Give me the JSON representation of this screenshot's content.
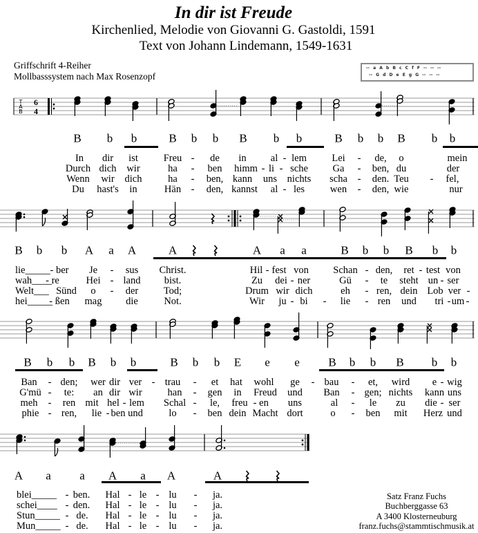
{
  "header": {
    "title": "In dir ist Freude",
    "subtitle_1": "Kirchenlied, Melodie von Giovanni G. Gastoldi, 1591",
    "subtitle_2": "Text von Johann Lindemann, 1549-1631"
  },
  "info": {
    "line_1": "Griffschrift 4-Reiher",
    "line_2": "Mollbasssystem nach Max Rosenzopf"
  },
  "legend": {
    "row_1": "-- a A b B c C f F -- -- --",
    "row_2": "-- G d D e E g G -- -- --"
  },
  "tab_label": [
    "T",
    "A",
    "B"
  ],
  "time_signature": {
    "top": "6",
    "bottom": "4"
  },
  "systems": [
    {
      "bass": [
        "B",
        "b",
        "b",
        "B",
        "b",
        "b",
        "B",
        "b",
        "b",
        "B",
        "b",
        "b",
        "B",
        "b",
        "b"
      ],
      "verses": [
        [
          "In",
          "dir",
          "ist",
          "Freu",
          "-",
          "de",
          "in",
          "al",
          "-",
          "lem",
          "Lei",
          "-",
          "de,",
          "o",
          "mein"
        ],
        [
          "Durch",
          "dich",
          "wir",
          "ha",
          "-",
          "ben",
          "himm",
          "-",
          "li",
          "-",
          "sche",
          "Ga",
          "-",
          "ben,",
          "du",
          "der"
        ],
        [
          "Wenn",
          "wir",
          "dich",
          "ha",
          "-",
          "ben,",
          "kann",
          "uns",
          "nichts",
          "scha",
          "-",
          "den.",
          "Teu",
          "-",
          "fel,"
        ],
        [
          "Du",
          "hast's",
          "in",
          "Hän",
          "-",
          "den,",
          "kannst",
          "al",
          "-",
          "les",
          "wen",
          "-",
          "den,",
          "wie",
          "nur"
        ]
      ]
    },
    {
      "bass": [
        "B",
        "b",
        "b",
        "A",
        "a",
        "A",
        "A",
        "rest",
        "rest",
        "A",
        "a",
        "a",
        "B",
        "b",
        "b",
        "B",
        "b",
        "b"
      ],
      "verses": [
        [
          "lie_____",
          "- ber",
          "Je",
          "-",
          "sus",
          "Christ.",
          "Hil",
          "-",
          "fest",
          "von",
          "Schan",
          "-",
          "den,",
          "ret",
          "-",
          "test",
          "von"
        ],
        [
          "wah____",
          "- re",
          "Hei",
          "-",
          "land",
          "bist.",
          "Zu",
          "dei",
          "-",
          "ner",
          "Gü",
          "-",
          "te",
          "steht",
          "un",
          "-",
          "ser"
        ],
        [
          "Welt___",
          "Sünd",
          "o",
          "-",
          "der",
          "Tod;",
          "Drum",
          "wir",
          "dich",
          "eh",
          "-",
          "ren,",
          "dein",
          "Lob",
          "ver",
          "-"
        ],
        [
          "hei_____",
          "- ßen",
          "mag",
          "die",
          "Not.",
          "Wir",
          "ju",
          "-",
          "bi",
          "-",
          "lie",
          "-",
          "ren",
          "und",
          "tri",
          "-",
          "um",
          "-"
        ]
      ]
    },
    {
      "bass": [
        "B",
        "b",
        "b",
        "B",
        "b",
        "b",
        "B",
        "b",
        "b",
        "E",
        "e",
        "e",
        "B",
        "b",
        "b",
        "B",
        "b",
        "b"
      ],
      "verses": [
        [
          "Ban",
          "-",
          "den;",
          "wer",
          "dir",
          "ver",
          "-",
          "trau",
          "-",
          "et",
          "hat",
          "wohl",
          "ge",
          "-",
          "bau",
          "-",
          "et,",
          "wird",
          "e",
          "-",
          "wig"
        ],
        [
          "G'mü",
          "-",
          "te:",
          "an",
          "dir",
          "wir",
          "han",
          "-",
          "gen",
          "in",
          "Freud",
          "und",
          "Ban",
          "-",
          "gen;",
          "nichts",
          "kann",
          "uns"
        ],
        [
          "meh",
          "-",
          "ren",
          "mit",
          "hel",
          "-",
          "lem",
          "Schal",
          "-",
          "le,",
          "freu",
          "-",
          "en",
          "uns",
          "al",
          "-",
          "le",
          "zu",
          "die",
          "-",
          "ser"
        ],
        [
          "phie",
          "-",
          "ren,",
          "lie",
          "-",
          "ben",
          "und",
          "lo",
          "-",
          "ben",
          "dein",
          "Macht",
          "dort",
          "o",
          "-",
          "ben",
          "mit",
          "Herz",
          "und"
        ]
      ]
    },
    {
      "bass": [
        "A",
        "a",
        "a",
        "A",
        "a",
        "A",
        "A",
        "rest",
        "rest"
      ],
      "verses": [
        [
          "blei_____",
          "-",
          "ben.",
          "Hal",
          "-",
          "le",
          "-",
          "lu",
          "-",
          "ja."
        ],
        [
          "schei____",
          "-",
          "den.",
          "Hal",
          "-",
          "le",
          "-",
          "lu",
          "-",
          "ja."
        ],
        [
          "Stun_____",
          "-",
          "de.",
          "Hal",
          "-",
          "le",
          "-",
          "lu",
          "-",
          "ja."
        ],
        [
          "Mun_____",
          "-",
          "de.",
          "Hal",
          "-",
          "le",
          "-",
          "lu",
          "-",
          "ja."
        ]
      ]
    }
  ],
  "credit": {
    "line_1": "Satz Franz Fuchs",
    "line_2": "Buchberggasse 63",
    "line_3": "A 3400 Klosterneuburg",
    "line_4": "franz.fuchs@stammtischmusik.at"
  }
}
